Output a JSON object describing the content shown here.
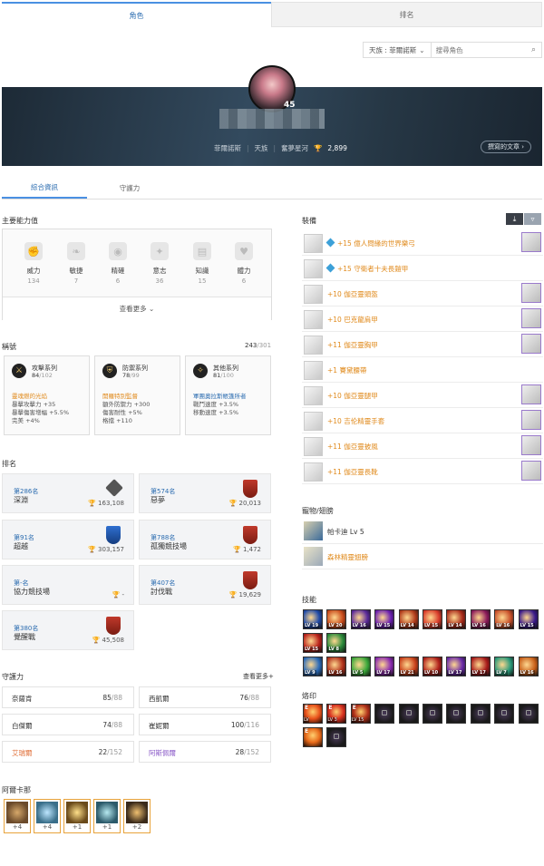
{
  "top_tabs": {
    "character": "角色",
    "ranking": "排名"
  },
  "search": {
    "server": "天族 : 菲爾諾斯",
    "placeholder": "搜尋角色"
  },
  "profile": {
    "level": "45",
    "server": "菲爾諾斯",
    "race": "天族",
    "legion": "奮夢星河",
    "trophy": "2,899",
    "posts_button": "撰寫的文章"
  },
  "sub_tabs": {
    "overview": "綜合資訊",
    "guardian": "守護力"
  },
  "main_stats": {
    "title": "主要能力值",
    "items": [
      {
        "label": "威力",
        "value": "134",
        "icon": "fist-icon"
      },
      {
        "label": "敏捷",
        "value": "7",
        "icon": "feather-icon"
      },
      {
        "label": "精確",
        "value": "6",
        "icon": "eye-icon"
      },
      {
        "label": "意志",
        "value": "36",
        "icon": "spirit-icon"
      },
      {
        "label": "知識",
        "value": "15",
        "icon": "book-icon"
      },
      {
        "label": "體力",
        "value": "6",
        "icon": "heart-icon"
      }
    ],
    "more": "查看更多"
  },
  "titles": {
    "label": "稱號",
    "count": "243",
    "total": "/301",
    "cards": [
      {
        "name": "攻擊系列",
        "count": "84",
        "total": "/102",
        "head": "靈魂燃的光焰",
        "lines": [
          "暴擊攻擊力 +35",
          "暴擊傷害增幅 +5.5%",
          "完美 +4%"
        ],
        "color": "orange"
      },
      {
        "name": "防禦系列",
        "count": "78",
        "total": "/99",
        "head": "開羅特別監督",
        "lines": [
          "額外防禦力 +300",
          "傷害耐性 +5%",
          "格擋 +110"
        ],
        "color": "orange"
      },
      {
        "name": "其他系列",
        "count": "81",
        "total": "/100",
        "head": "軍團奧拉斯帳篷所者",
        "lines": [
          "戰鬥速度 +3.5%",
          "移動速度 +3.5%"
        ],
        "color": "blue"
      }
    ]
  },
  "ranking": {
    "title": "排名",
    "cards": [
      {
        "rank": "第286名",
        "name": "深淵",
        "score": "163,108",
        "badge": "gray"
      },
      {
        "rank": "第574名",
        "name": "惡夢",
        "score": "20,013",
        "badge": "red"
      },
      {
        "rank": "第91名",
        "name": "超越",
        "score": "303,157",
        "badge": "blue"
      },
      {
        "rank": "第788名",
        "name": "孤獨競技場",
        "score": "1,472",
        "badge": "red"
      },
      {
        "rank": "第-名",
        "name": "協力競技場",
        "score": "-",
        "badge": "none"
      },
      {
        "rank": "第407名",
        "name": "討伐戰",
        "score": "19,629",
        "badge": "red"
      },
      {
        "rank": "第380名",
        "name": "覺醒戰",
        "score": "45,508",
        "badge": "red"
      }
    ]
  },
  "guardian": {
    "title": "守護力",
    "more": "查看更多",
    "rows": [
      {
        "name": "奈薩肯",
        "value": "85",
        "max": "/88",
        "color": "#333333"
      },
      {
        "name": "西凱爾",
        "value": "76",
        "max": "/88",
        "color": "#333333"
      },
      {
        "name": "白傑爾",
        "value": "74",
        "max": "/88",
        "color": "#333333"
      },
      {
        "name": "崔妮爾",
        "value": "100",
        "max": "/116",
        "color": "#333333"
      },
      {
        "name": "艾瑞爾",
        "value": "22",
        "max": "/152",
        "color": "#e0703a"
      },
      {
        "name": "阿斯佩爾",
        "value": "28",
        "max": "/152",
        "color": "#8a5ac8"
      }
    ]
  },
  "daevanion": {
    "title": "阿爾卡那",
    "cards": [
      "+4",
      "+4",
      "+1",
      "+1",
      "+2"
    ]
  },
  "equipment": {
    "title": "裝備",
    "items": [
      {
        "name": "+15 億人問緣的世界樂弓",
        "diamond": true,
        "extra": true
      },
      {
        "name": "+15 守衛者十夫長鎧甲",
        "diamond": true,
        "extra": false
      },
      {
        "name": "+10 伽亞靈頭盔",
        "diamond": false,
        "extra": true
      },
      {
        "name": "+10 巴克龍肩甲",
        "diamond": false,
        "extra": true
      },
      {
        "name": "+11 伽亞靈胸甲",
        "diamond": false,
        "extra": true
      },
      {
        "name": "+1 賽黛腰帶",
        "diamond": false,
        "extra": false
      },
      {
        "name": "+10 伽亞靈腿甲",
        "diamond": false,
        "extra": true
      },
      {
        "name": "+10 吉伦精靈手套",
        "diamond": false,
        "extra": true
      },
      {
        "name": "+11 伽亞靈披風",
        "diamond": false,
        "extra": true
      },
      {
        "name": "+11 伽亞靈長靴",
        "diamond": false,
        "extra": true
      }
    ]
  },
  "pets": {
    "title": "寵物/翅膀",
    "items": [
      {
        "name": "帕卡迪 Lv 5",
        "orange": false
      },
      {
        "name": "森林精靈翅膀",
        "orange": true
      }
    ]
  },
  "skills": {
    "title": "技能",
    "levels_row1": [
      "LV 19",
      "LV 20",
      "LV 16",
      "LV 15",
      "LV 14",
      "LV 15",
      "LV 14",
      "LV 16",
      "LV 16",
      "LV 15"
    ],
    "levels_row2": [
      "LV 15",
      "LV 8"
    ],
    "levels_row3": [
      "LV 9",
      "LV 16",
      "LV 5",
      "LV 17",
      "LV 21",
      "LV 10",
      "LV 17",
      "LV 17",
      "LV 7",
      "LV 16"
    ]
  },
  "stigma": {
    "title": "烙印",
    "slot_e": "E",
    "levels": [
      "LV",
      "LV 3",
      "LV 15"
    ]
  }
}
